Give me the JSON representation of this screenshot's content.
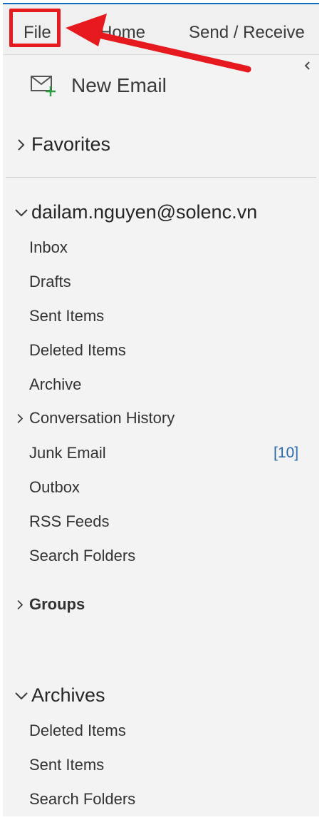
{
  "ribbon": {
    "tabs": [
      {
        "label": "File"
      },
      {
        "label": "Home"
      },
      {
        "label": "Send / Receive"
      }
    ]
  },
  "sidebar": {
    "new_email_label": "New Email",
    "favorites_label": "Favorites",
    "account": {
      "label": "dailam.nguyen@solenc.vn",
      "folders": [
        {
          "label": "Inbox"
        },
        {
          "label": "Drafts"
        },
        {
          "label": "Sent Items"
        },
        {
          "label": "Deleted Items"
        },
        {
          "label": "Archive"
        },
        {
          "label": "Conversation History"
        },
        {
          "label": "Junk Email",
          "count": "[10]"
        },
        {
          "label": "Outbox"
        },
        {
          "label": "RSS Feeds"
        },
        {
          "label": "Search Folders"
        }
      ]
    },
    "groups_label": "Groups",
    "archives": {
      "label": "Archives",
      "folders": [
        {
          "label": "Deleted Items"
        },
        {
          "label": "Sent Items"
        },
        {
          "label": "Search Folders"
        }
      ]
    }
  },
  "annotation": {
    "highlight_color": "#e6191e",
    "arrow_color": "#e6191e"
  },
  "colors": {
    "accent": "#0f6cbd",
    "count": "#2b6cb0",
    "new_email_plus": "#2e9e44"
  },
  "icons": {
    "new_email": "mail-plus-icon",
    "collapse": "chevron-left-icon",
    "expand": "chevron-right-icon",
    "collapse_section": "chevron-down-icon"
  }
}
